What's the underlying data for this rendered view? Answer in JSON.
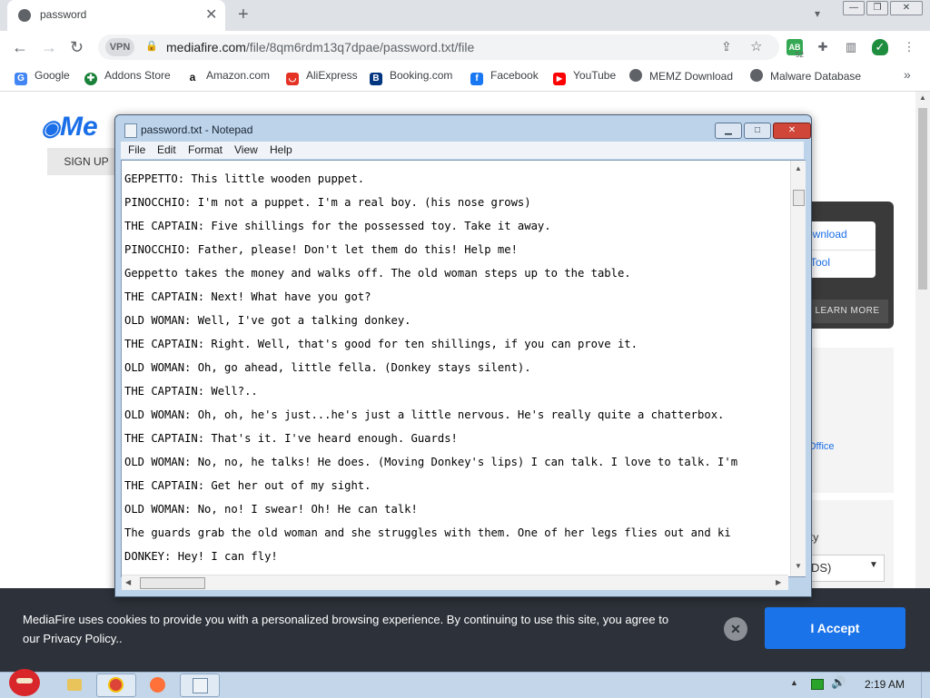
{
  "browser": {
    "tab_title": "password",
    "url_domain": "mediafire.com",
    "url_path": "/file/8qm6rdm13q7dpae/password.txt/file",
    "vpn_label": "VPN",
    "extension_badge": "52",
    "bookmarks": [
      {
        "label": "Google",
        "icon": "google-icon",
        "color": "#4285f4"
      },
      {
        "label": "Addons Store",
        "icon": "puzzle-icon",
        "color": "#188038"
      },
      {
        "label": "Amazon.com",
        "icon": "amazon-icon",
        "color": "#111111"
      },
      {
        "label": "AliExpress",
        "icon": "aliexpress-icon",
        "color": "#e43225"
      },
      {
        "label": "Booking.com",
        "icon": "booking-icon",
        "color": "#003580"
      },
      {
        "label": "Facebook",
        "icon": "facebook-icon",
        "color": "#1877f2"
      },
      {
        "label": "YouTube",
        "icon": "youtube-icon",
        "color": "#ff0000"
      },
      {
        "label": "MEMZ Download",
        "icon": "globe-icon",
        "color": "#5f6368"
      },
      {
        "label": "Malware Database",
        "icon": "globe-icon",
        "color": "#5f6368"
      }
    ]
  },
  "page": {
    "logo_text": "Me",
    "signup_label": "SIGN UP",
    "download_link_1": "ownload",
    "download_link_2": "Tool",
    "learn_more_label": "LEARN MORE",
    "panel2_link": "Office",
    "panel3_label": "ty",
    "panel3_select": "DS)"
  },
  "notepad": {
    "title": "password.txt - Notepad",
    "menu": [
      "File",
      "Edit",
      "Format",
      "View",
      "Help"
    ],
    "lines": [
      "GEPPETTO: This little wooden puppet.",
      "PINOCCHIO: I'm not a puppet. I'm a real boy. (his nose grows)",
      "THE CAPTAIN: Five shillings for the possessed toy. Take it away.",
      "PINOCCHIO: Father, please! Don't let them do this! Help me!",
      "Geppetto takes the money and walks off. The old woman steps up to the table.",
      "THE CAPTAIN: Next! What have you got?",
      "OLD WOMAN: Well, I've got a talking donkey.",
      "THE CAPTAIN: Right. Well, that's good for ten shillings, if you can prove it.",
      "OLD WOMAN: Oh, go ahead, little fella. (Donkey stays silent).",
      "THE CAPTAIN: Well?..",
      "OLD WOMAN: Oh, oh, he's just...he's just a little nervous. He's really quite a chatterbox.",
      "THE CAPTAIN: That's it. I've heard enough. Guards!",
      "OLD WOMAN: No, no, he talks! He does. (Moving Donkey's lips) I can talk. I love to talk. I'm",
      "THE CAPTAIN: Get her out of my sight.",
      "OLD WOMAN: No, no! I swear! Oh! He can talk!",
      "The guards grab the old woman and she struggles with them. One of her legs flies out and ki",
      "DONKEY: Hey! I can fly!"
    ]
  },
  "cookie": {
    "text": "MediaFire uses cookies to provide you with a personalized browsing experience. By continuing to use this site, you agree to our Privacy Policy..",
    "accept_label": "I Accept"
  },
  "taskbar": {
    "clock": "2:19 AM"
  }
}
